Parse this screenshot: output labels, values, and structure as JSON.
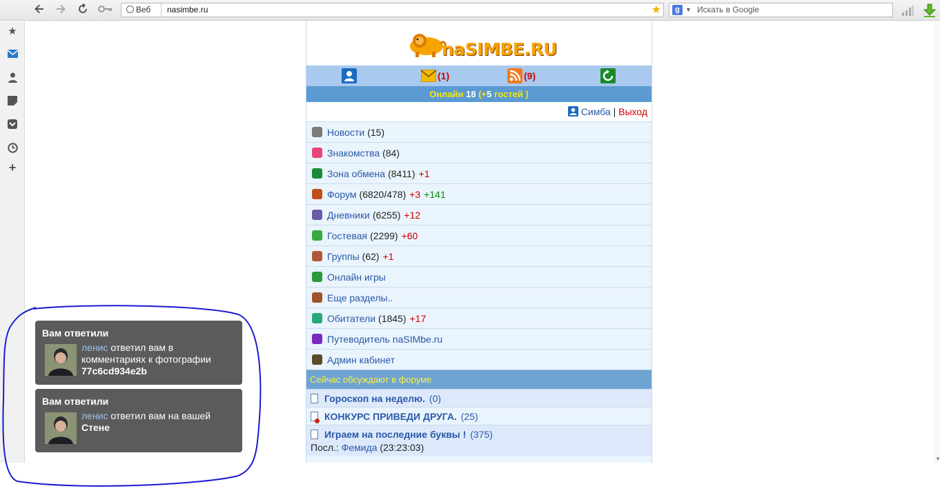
{
  "browser": {
    "web_chip": "Веб",
    "url": "nasimbe.ru",
    "search_placeholder": "Искать в Google",
    "icons": [
      "back-icon",
      "forward-icon",
      "reload-icon",
      "key-icon",
      "star-icon",
      "signal-icon",
      "download-icon"
    ]
  },
  "sidebar": {
    "icons": [
      "star-icon",
      "mail-icon",
      "person-icon",
      "note-icon",
      "pocket-icon",
      "clock-icon",
      "plus-icon"
    ]
  },
  "site": {
    "logo_text": "naSIMBE.RU",
    "iconbar": {
      "mail_count": "(1)",
      "rss_count": "(9)"
    },
    "online": {
      "label": "Онлайн",
      "count": "18",
      "guests_pre": "(+",
      "guests_num": "5",
      "guests_post": "гостей )"
    },
    "user": {
      "name": "Симба",
      "separator": "|",
      "logout": "Выход"
    },
    "menu": [
      {
        "label": "Новости",
        "count": "(15)",
        "red": "",
        "green": "",
        "color": "#7a7a7a"
      },
      {
        "label": "Знакомства",
        "count": "(84)",
        "red": "",
        "green": "",
        "color": "#e8457a"
      },
      {
        "label": "Зона обмена",
        "count": "(8411)",
        "red": "+1",
        "green": "",
        "color": "#1a8a3a"
      },
      {
        "label": "Форум",
        "count": "(6820/478)",
        "red": "+3",
        "green": "+141",
        "color": "#c0501a"
      },
      {
        "label": "Дневники",
        "count": "(6255)",
        "red": "+12",
        "green": "",
        "color": "#6a5aa8"
      },
      {
        "label": "Гостевая",
        "count": "(2299)",
        "red": "+60",
        "green": "",
        "color": "#3aa83a"
      },
      {
        "label": "Группы",
        "count": "(62)",
        "red": "+1",
        "green": "",
        "color": "#b05a3a"
      },
      {
        "label": "Онлайн игры",
        "count": "",
        "red": "",
        "green": "",
        "color": "#2a9a3a"
      },
      {
        "label": "Еще разделы..",
        "count": "",
        "red": "",
        "green": "",
        "color": "#a0522d"
      },
      {
        "label": "Обитатели",
        "count": "(1845)",
        "red": "+17",
        "green": "",
        "color": "#2aa87a"
      },
      {
        "label": "Путеводитель naSIMbe.ru",
        "count": "",
        "red": "",
        "green": "",
        "color": "#7a2ac0"
      },
      {
        "label": "Админ кабинет",
        "count": "",
        "red": "",
        "green": "",
        "color": "#5a4a2a"
      }
    ],
    "forum_header": "Сейчас обсуждают в форуме",
    "topics": [
      {
        "title": "Гороскоп на неделю.",
        "count": "(0)",
        "last_label": "",
        "last_user": "",
        "last_time": ""
      },
      {
        "title": "КОНКУРС ПРИВЕДИ ДРУГА.",
        "count": "(25)",
        "last_label": "",
        "last_user": "",
        "last_time": ""
      },
      {
        "title": "Играем на последние буквы !",
        "count": "(375)",
        "last_label": "Посл.:",
        "last_user": "Фемида",
        "last_time": "(23:23:03)"
      }
    ]
  },
  "notifications": [
    {
      "title": "Вам ответили",
      "user": "ленис",
      "text": "ответил вам в комментариях к фотографии",
      "strong": "77c6cd934e2b"
    },
    {
      "title": "Вам ответили",
      "user": "ленис",
      "text": "ответил вам на вашей",
      "strong": "Стене"
    }
  ],
  "colors": {
    "iconbar": "#a9c9ee",
    "online_bar": "#5b9ad2",
    "forum_header": "#6fa3d1",
    "notification_bg": "#5b5b5b",
    "annotation_circle": "#1a1ad0"
  }
}
